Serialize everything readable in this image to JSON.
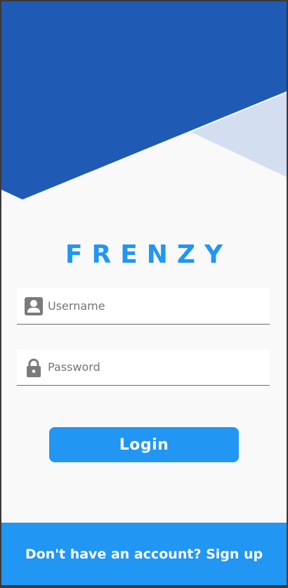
{
  "app": {
    "brand": "FRENZY"
  },
  "login_form": {
    "username": {
      "placeholder": "Username",
      "value": "",
      "icon": "user-icon"
    },
    "password": {
      "placeholder": "Password",
      "value": "",
      "icon": "lock-icon"
    },
    "submit_label": "Login"
  },
  "footer": {
    "signup_prompt": "Don't have an account? Sign up"
  },
  "colors": {
    "primary": "#2196f3",
    "header_dark_blue": "#1f5bb5",
    "header_light_blue": "#d3dff0",
    "background": "#f9f9f9",
    "icon_gray": "#7a7a7a"
  }
}
